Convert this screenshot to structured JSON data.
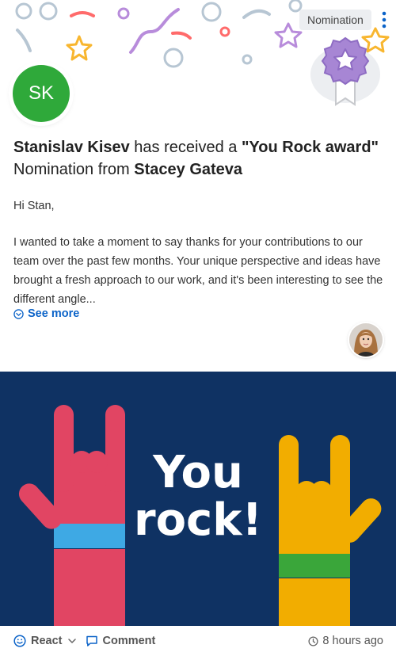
{
  "badge": {
    "label": "Nomination"
  },
  "recipient": {
    "initials": "SK",
    "name": "Stanislav Kisev"
  },
  "headline": {
    "recipient_name": "Stanislav Kisev",
    "received_text": " has received a ",
    "award_name": "\"You Rock award\"",
    "nomination_text": "Nomination from ",
    "sender_name": "Stacey Gateva"
  },
  "message": {
    "greeting": "Hi Stan,",
    "body": "I wanted to take a moment to say thanks for your contributions to our team over the past few months. Your unique perspective and ideas have brought a fresh approach to our work, and it's been interesting to see the different angle..."
  },
  "see_more_label": "See more",
  "card_image": {
    "text_line1": "You",
    "text_line2": "rock!"
  },
  "footer": {
    "react_label": "React",
    "comment_label": "Comment",
    "timestamp": "8 hours ago"
  },
  "colors": {
    "accent": "#0b63c8",
    "avatar_bg": "#2fa93a",
    "card_bg": "#0f3263",
    "left_hand": "#e14563",
    "right_hand": "#f2ad00",
    "left_band": "#3ea9e4",
    "right_band": "#3aa63a"
  }
}
